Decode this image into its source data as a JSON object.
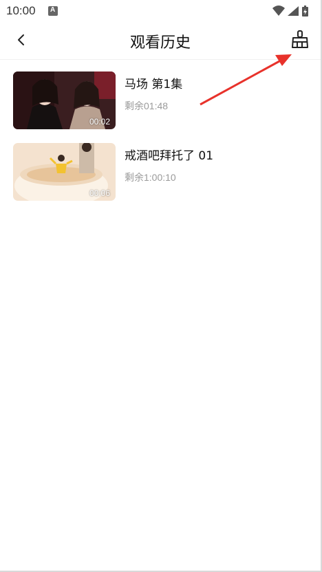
{
  "status_bar": {
    "time": "10:00",
    "notification_icon": "A",
    "icons": [
      "wifi-icon",
      "signal-icon",
      "battery-icon"
    ]
  },
  "header": {
    "title": "观看历史",
    "back_icon": "chevron-left-icon",
    "clear_icon": "broom-icon"
  },
  "history": [
    {
      "title": "马场 第1集",
      "remaining": "剩余01:48",
      "duration": "00:02"
    },
    {
      "title": "戒酒吧拜托了 01",
      "remaining": "剩余1:00:10",
      "duration": "00:06"
    }
  ],
  "annotation": {
    "color": "#e8322b"
  }
}
